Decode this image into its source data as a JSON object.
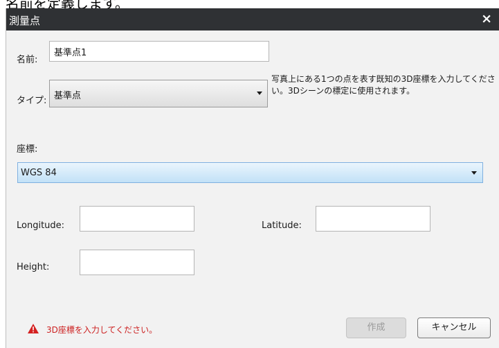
{
  "background_text": "名前を定義します。",
  "dialog": {
    "title": "測量点",
    "close_glyph": "×"
  },
  "form": {
    "name_label": "名前:",
    "name_value": "基準点1",
    "type_label": "タイプ:",
    "type_value": "基準点",
    "help_text": "写真上にある1つの点を表す既知の3D座標を入力してください。3Dシーンの標定に使用されます。",
    "coords_label": "座標:",
    "crs_value": "WGS 84",
    "longitude_label": "Longitude:",
    "longitude_value": "",
    "latitude_label": "Latitude:",
    "latitude_value": "",
    "height_label": "Height:",
    "height_value": ""
  },
  "footer": {
    "warning_icon": "warning-triangle-icon",
    "warning_text": "3D座標を入力してください。",
    "create_label": "作成",
    "cancel_label": "キャンセル"
  },
  "colors": {
    "titlebar": "#2f3134",
    "warning": "#cc1f1f",
    "crs_highlight": "#c2e1f7"
  }
}
